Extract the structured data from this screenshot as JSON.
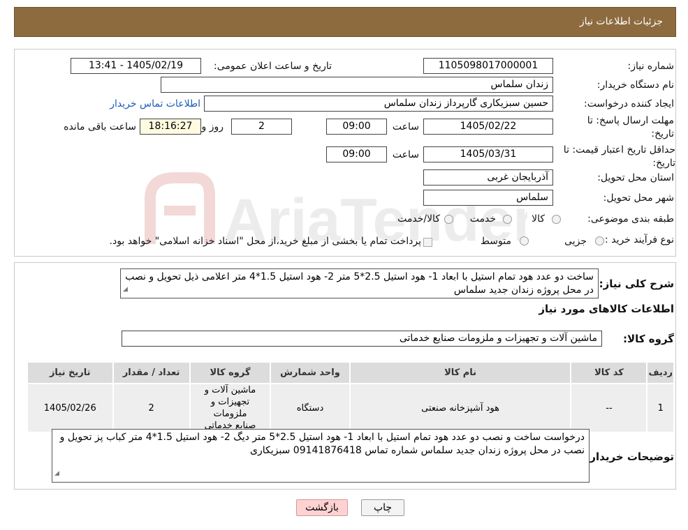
{
  "header": {
    "title": "جزئیات اطلاعات نیاز"
  },
  "form": {
    "need_number_label": "شماره نیاز:",
    "need_number": "1105098017000001",
    "announce_label": "تاریخ و ساعت اعلان عمومی:",
    "announce_value": "1405/02/19 - 13:41",
    "buyer_org_label": "نام دستگاه خریدار:",
    "buyer_org": "زندان سلماس",
    "requester_label": "ایجاد کننده درخواست:",
    "requester": "حسین سبزیکاری گارپرداز زندان سلماس",
    "contact_link": "اطلاعات تماس خریدار",
    "reply_deadline_label": "مهلت ارسال پاسخ: تا تاریخ:",
    "reply_date": "1405/02/22",
    "time_label": "ساعت",
    "reply_time": "09:00",
    "days": "2",
    "days_label": "روز و",
    "remaining_time": "18:16:27",
    "remaining_label": "ساعت باقی مانده",
    "price_validity_label": "حداقل تاریخ اعتبار قیمت: تا تاریخ:",
    "price_date": "1405/03/31",
    "price_time": "09:00",
    "province_label": "استان محل تحویل:",
    "province": "آذربایجان غربی",
    "city_label": "شهر محل تحویل:",
    "city": "سلماس",
    "category_label": "طبقه بندی موضوعی:",
    "category_options": [
      "کالا",
      "خدمت",
      "کالا/خدمت"
    ],
    "process_label": "نوع فرآیند خرید :",
    "process_options": [
      "جزیی",
      "متوسط"
    ],
    "process_note": "پرداخت تمام یا بخشی از مبلغ خرید،از محل \"اسناد خزانه اسلامی\" خواهد بود."
  },
  "summary": {
    "label": "شرح کلی نیاز:",
    "text": "ساخت دو عدد هود تمام استیل با ابعاد 1- هود استیل 2.5*5 متر  2- هود استیل 1.5*4 متر اعلامی ذیل تحویل و نصب در محل پروژه زندان جدید سلماس",
    "items_title": "اطلاعات کالاهای مورد نیاز",
    "group_label": "گروه کالا:",
    "group_value": "ماشین آلات و تجهیزات و ملزومات صنایع خدماتی"
  },
  "table": {
    "headers": [
      "ردیف",
      "کد کالا",
      "نام کالا",
      "واحد شمارش",
      "گروه کالا",
      "تعداد / مقدار",
      "تاریخ نیاز"
    ],
    "rows": [
      {
        "row": "1",
        "code": "--",
        "name": "هود آشپزخانه صنعتی",
        "unit": "دستگاه",
        "group": "ماشین آلات و تجهیزات و ملزومات صنایع خدماتی",
        "qty": "2",
        "date": "1405/02/26"
      }
    ]
  },
  "buyer_notes": {
    "label": "توضیحات خریدار:",
    "text": "درخواست ساخت و نصب دو عدد هود تمام استیل با ابعاد 1- هود استیل 2.5*5 متر دیگ  2- هود استیل 1.5*4 متر کباب پز تحویل و نصب در محل پروژه زندان جدید سلماس شماره تماس 09141876418 سبزیکاری"
  },
  "buttons": {
    "print": "چاپ",
    "back": "بازگشت"
  },
  "watermark": {
    "text": "AriaTender.neT"
  }
}
